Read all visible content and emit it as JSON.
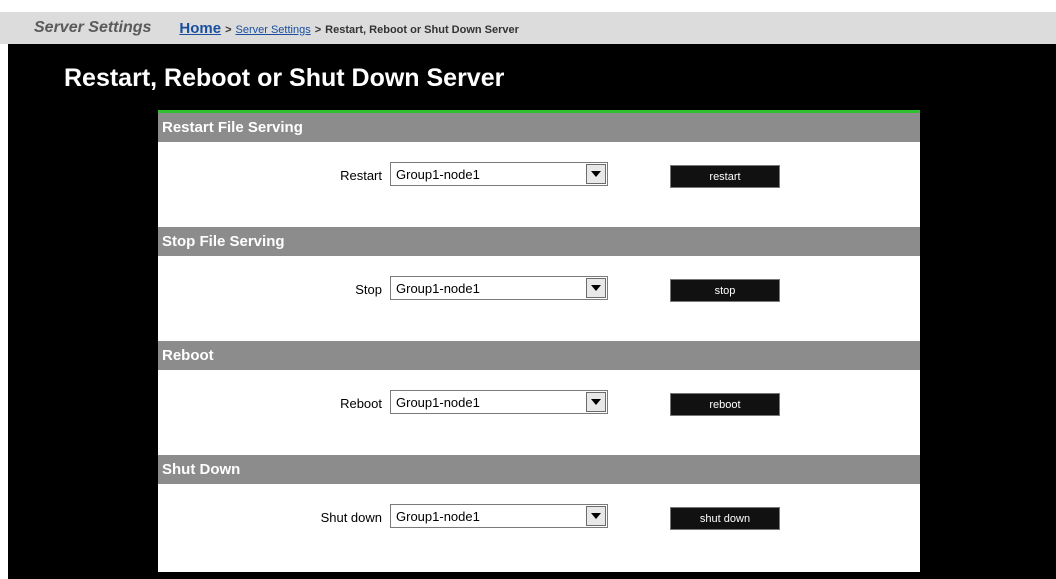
{
  "breadcrumb": {
    "section_title": "Server Settings",
    "home": "Home",
    "separator": ">",
    "server_settings": "Server Settings",
    "current": "Restart, Reboot or Shut Down Server"
  },
  "page_title": "Restart, Reboot or Shut Down Server",
  "sections": [
    {
      "header": "Restart File Serving",
      "label": "Restart",
      "selected": "Group1-node1",
      "button": "restart"
    },
    {
      "header": "Stop File Serving",
      "label": "Stop",
      "selected": "Group1-node1",
      "button": "stop"
    },
    {
      "header": "Reboot",
      "label": "Reboot",
      "selected": "Group1-node1",
      "button": "reboot"
    },
    {
      "header": "Shut Down",
      "label": "Shut down",
      "selected": "Group1-node1",
      "button": "shut down"
    }
  ],
  "colors": {
    "accent_bar": "#2fbf2f",
    "section_header": "#8c8c8c",
    "background": "#000000"
  }
}
